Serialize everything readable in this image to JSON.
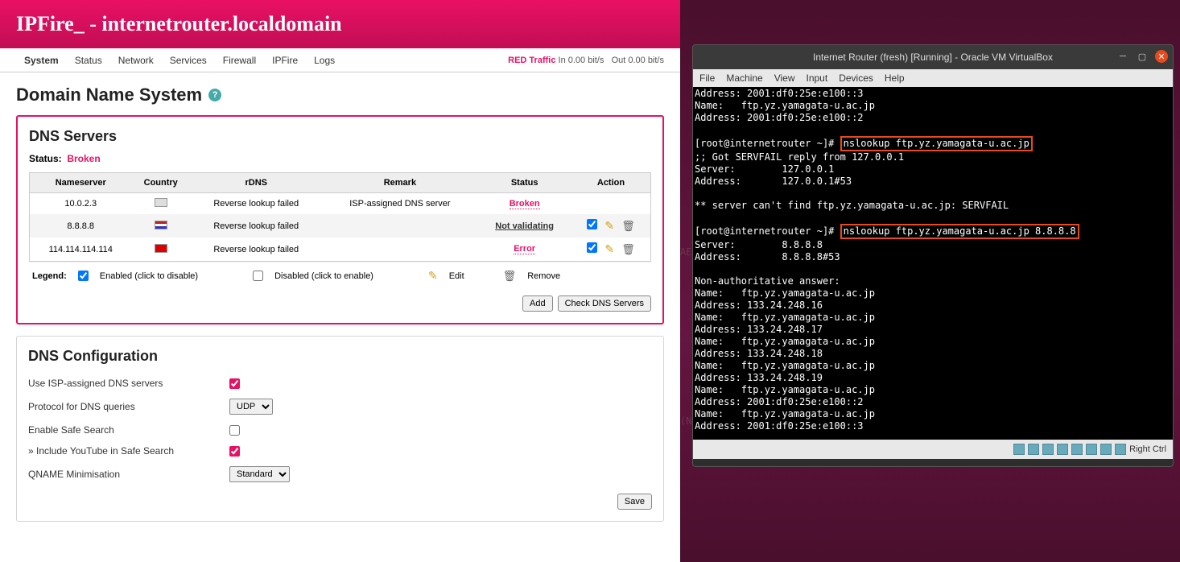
{
  "hero": {
    "title": "IPFire_ - internetrouter.localdomain"
  },
  "tabs": [
    "System",
    "Status",
    "Network",
    "Services",
    "Firewall",
    "IPFire",
    "Logs"
  ],
  "traffic": {
    "label": "RED Traffic",
    "in": "In 0.00 bit/s",
    "out": "Out 0.00 bit/s"
  },
  "page_title": "Domain Name System",
  "dns_servers": {
    "heading": "DNS Servers",
    "status_label": "Status:",
    "status_value": "Broken",
    "cols": [
      "Nameserver",
      "Country",
      "rDNS",
      "Remark",
      "Status",
      "Action"
    ],
    "rows": [
      {
        "ns": "10.0.2.3",
        "flag": "unk",
        "rdns": "Reverse lookup failed",
        "remark": "ISP-assigned DNS server",
        "status": "Broken",
        "status_cls": "broken",
        "actions": false
      },
      {
        "ns": "8.8.8.8",
        "flag": "us",
        "rdns": "Reverse lookup failed",
        "remark": "",
        "status": "Not validating",
        "status_cls": "notval",
        "actions": true
      },
      {
        "ns": "114.114.114.114",
        "flag": "cn",
        "rdns": "Reverse lookup failed",
        "remark": "",
        "status": "Error",
        "status_cls": "err",
        "actions": true
      }
    ],
    "legend": {
      "label": "Legend:",
      "enabled": "Enabled (click to disable)",
      "disabled": "Disabled (click to enable)",
      "edit": "Edit",
      "remove": "Remove"
    },
    "buttons": {
      "add": "Add",
      "check": "Check DNS Servers"
    }
  },
  "dns_config": {
    "heading": "DNS Configuration",
    "rows": [
      {
        "label": "Use ISP-assigned DNS servers",
        "type": "checkbox",
        "checked": true
      },
      {
        "label": "Protocol for DNS queries",
        "type": "select",
        "value": "UDP"
      },
      {
        "label": "Enable Safe Search",
        "type": "checkbox",
        "checked": false
      },
      {
        "label": "» Include YouTube in Safe Search",
        "type": "checkbox",
        "checked": true
      },
      {
        "label": "QNAME Minimisation",
        "type": "select",
        "value": "Standard"
      }
    ],
    "save": "Save"
  },
  "vbox": {
    "title": "Internet Router (fresh) [Running] - Oracle VM VirtualBox",
    "menu": [
      "File",
      "Machine",
      "View",
      "Input",
      "Devices",
      "Help"
    ],
    "status": "Right Ctrl",
    "term": {
      "pre1": "Address: 2001:df0:25e:e100::3\nName:   ftp.yz.yamagata-u.ac.jp\nAddress: 2001:df0:25e:e100::2\n\n[root@internetrouter ~]# ",
      "cmd1": "nslookup ftp.yz.yamagata-u.ac.jp",
      "mid1": "\n;; Got SERVFAIL reply from 127.0.0.1\nServer:        127.0.0.1\nAddress:       127.0.0.1#53\n\n** server can't find ftp.yz.yamagata-u.ac.jp: SERVFAIL\n\n[root@internetrouter ~]# ",
      "cmd2": "nslookup ftp.yz.yamagata-u.ac.jp 8.8.8.8",
      "post": "\nServer:        8.8.8.8\nAddress:       8.8.8.8#53\n\nNon-authoritative answer:\nName:   ftp.yz.yamagata-u.ac.jp\nAddress: 133.24.248.16\nName:   ftp.yz.yamagata-u.ac.jp\nAddress: 133.24.248.17\nName:   ftp.yz.yamagata-u.ac.jp\nAddress: 133.24.248.18\nName:   ftp.yz.yamagata-u.ac.jp\nAddress: 133.24.248.19\nName:   ftp.yz.yamagata-u.ac.jp\nAddress: 2001:df0:25e:e100::2\nName:   ftp.yz.yamagata-u.ac.jp\nAddress: 2001:df0:25e:e100::3\n\n[root@internetrouter ~]# _"
    }
  },
  "bg": {
    "l1": "AE/",
    "l2": "(N"
  }
}
